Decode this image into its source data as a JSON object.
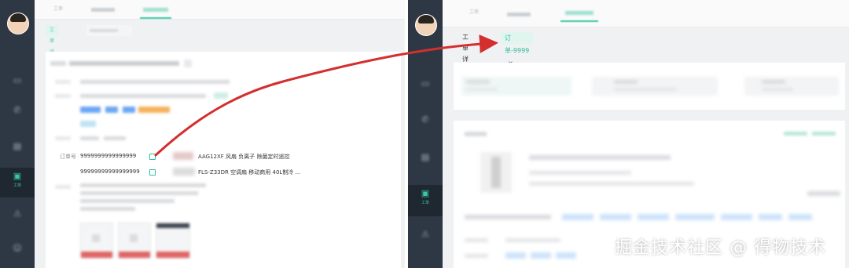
{
  "left_panel": {
    "sidebar": {
      "username": "",
      "items": [
        {
          "label": "",
          "icon": "monitor-icon"
        },
        {
          "label": "",
          "icon": "phone-icon"
        },
        {
          "label": "",
          "icon": "chart-icon"
        },
        {
          "label": "工单",
          "icon": "ticket-icon"
        },
        {
          "label": "",
          "icon": "warning-icon"
        },
        {
          "label": "",
          "icon": "user-icon"
        }
      ]
    },
    "top_tabs": [
      "工单",
      "",
      ""
    ],
    "sub_tabs": [
      {
        "label": "工单详情"
      },
      {
        "label": ""
      }
    ],
    "order_field_label": "订单号",
    "orders": [
      {
        "number": "9999999999999999",
        "product": "AAG12XF 风扇 负离子 除菌定时遥控"
      },
      {
        "number": "99999999999999999",
        "product": "FLS-Z33DR 空调扇 移动商用 40L制冷 ..."
      }
    ]
  },
  "right_panel": {
    "sidebar": {
      "username": "",
      "items": [
        {
          "label": "",
          "icon": "monitor-icon"
        },
        {
          "label": "",
          "icon": "phone-icon"
        },
        {
          "label": "",
          "icon": "chart-icon"
        },
        {
          "label": "工单",
          "icon": "ticket-icon"
        },
        {
          "label": "",
          "icon": "warning-icon"
        }
      ]
    },
    "top_tabs": [
      "工单",
      "",
      ""
    ],
    "sub_tabs": [
      {
        "label": "工单详情"
      },
      {
        "label": "订单-9999",
        "close": "×"
      }
    ]
  },
  "watermark": "掘金技术社区 @ 得物技术",
  "colors": {
    "sidebar_bg": "#2e3744",
    "accent": "#39c7a4",
    "arrow": "#d32f2f",
    "tag_blue": "#6aa6f5",
    "tag_orange": "#f5b25b"
  }
}
